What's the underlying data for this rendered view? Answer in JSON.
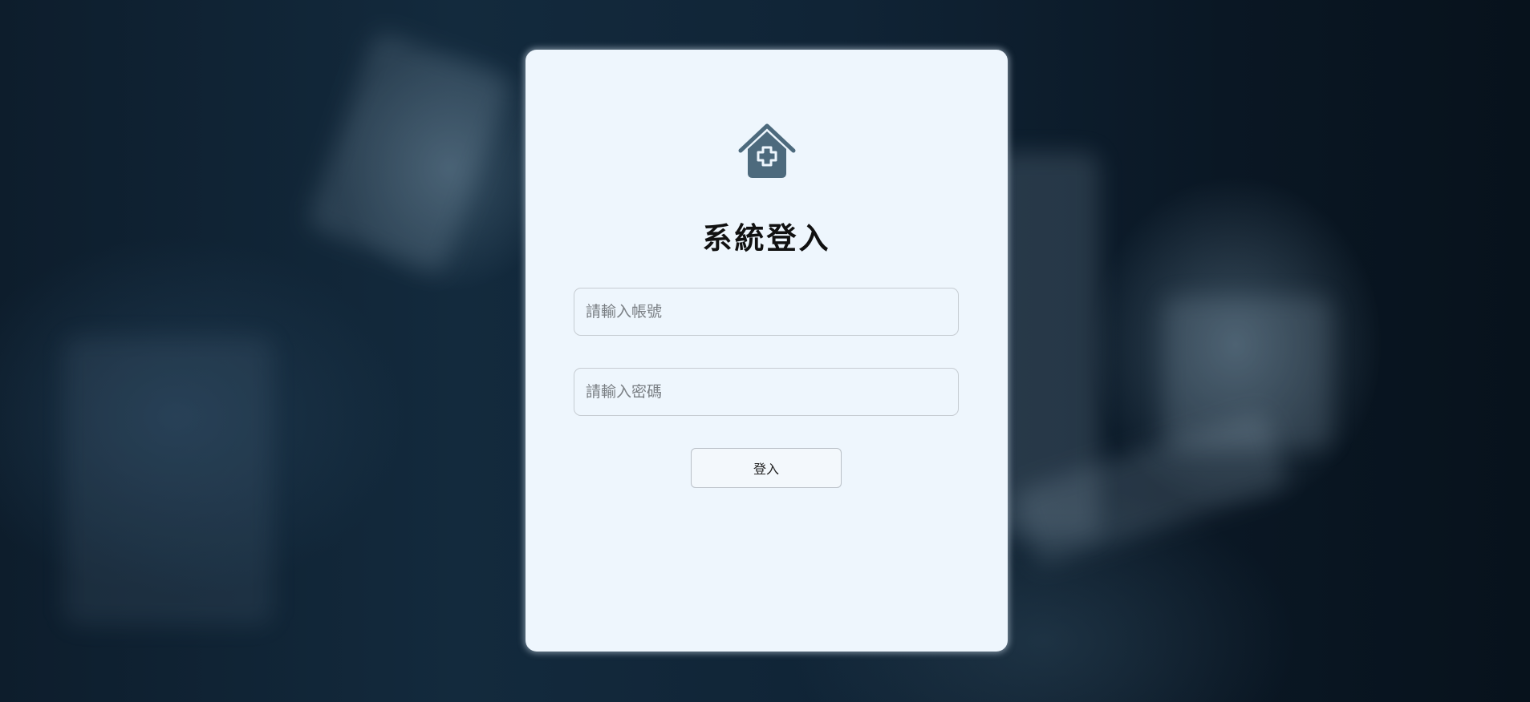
{
  "login": {
    "title": "系統登入",
    "username_placeholder": "請輸入帳號",
    "username_value": "",
    "password_placeholder": "請輸入密碼",
    "password_value": "",
    "submit_label": "登入"
  },
  "icons": {
    "logo": "hospital-house-cross-icon"
  },
  "colors": {
    "card_background": "#eef6fd",
    "logo_color": "#4d6a7d",
    "title_color": "#111111",
    "background_dark": "#0d1d2c"
  }
}
